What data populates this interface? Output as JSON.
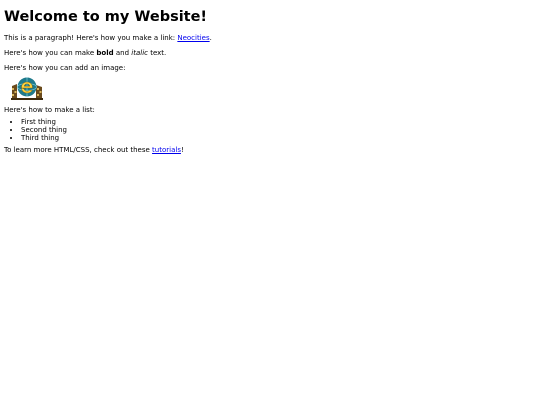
{
  "heading": "Welcome to my Website!",
  "paragraph1": {
    "before": "This is a paragraph! Here's how you make a link: ",
    "link": "Neocities",
    "after": "."
  },
  "paragraph2": {
    "before": "Here's how you can make ",
    "bold": "bold",
    "middle": " and ",
    "italic": "italic",
    "after": " text."
  },
  "paragraph3": "Here's how you can add an image:",
  "image": {
    "icon": "site-logo-e-globe-icon"
  },
  "paragraph4": "Here's how to make a list:",
  "list": [
    "First thing",
    "Second thing",
    "Third thing"
  ],
  "paragraph5": {
    "before": "To learn more HTML/CSS, check out these ",
    "link": "tutorials",
    "after": "!"
  },
  "colors": {
    "link": "#0000ee",
    "text": "#000000",
    "background": "#ffffff"
  }
}
